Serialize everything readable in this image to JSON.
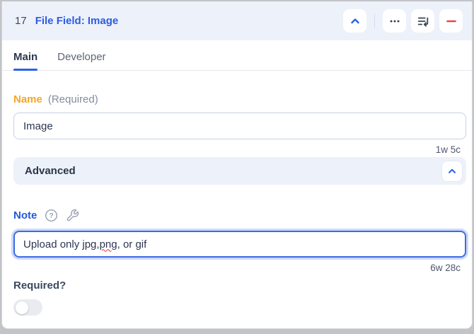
{
  "header": {
    "index": "17",
    "title": "File Field: Image",
    "buttons": {
      "collapse": "chevron-up-icon",
      "menu": "ellipsis-icon",
      "insert_after": "list-return-icon",
      "remove": "minus-icon"
    }
  },
  "tabs": [
    {
      "label": "Main",
      "active": true
    },
    {
      "label": "Developer",
      "active": false
    }
  ],
  "name_field": {
    "label": "Name",
    "required_note": "(Required)",
    "value": "Image",
    "counter": "1w 5c"
  },
  "advanced_section": {
    "label": "Advanced",
    "expanded": true
  },
  "note_field": {
    "label": "Note",
    "icons": [
      "help-circle-icon",
      "wrench-icon"
    ],
    "value": "Upload only jpg, png, or gif",
    "value_before": "Upload only jpg, ",
    "value_misspelled": "png",
    "value_after": ", or gif",
    "counter": "6w 28c"
  },
  "required_field": {
    "label": "Required?",
    "toggle_on": false
  },
  "colors": {
    "accent_blue": "#2563eb",
    "title_blue": "#2b5ce2",
    "header_bg": "#edf1fa",
    "label_orange": "#f6a623",
    "remove_red": "#e5484d",
    "spellcheck_red": "#e0312e",
    "focus_ring": "#ccdaf6",
    "input_border": "#c7d2e6"
  }
}
